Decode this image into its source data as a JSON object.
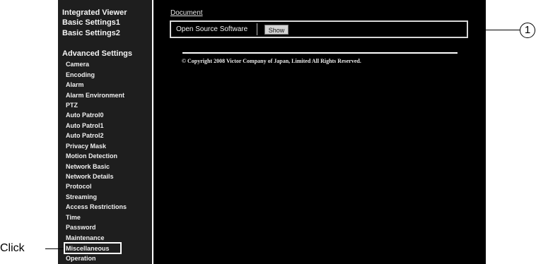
{
  "sidebar": {
    "top_links": [
      "Integrated Viewer",
      "Basic Settings1",
      "Basic Settings2"
    ],
    "section_heading": "Advanced Settings",
    "items": [
      "Camera",
      "Encoding",
      "Alarm",
      "Alarm Environment",
      "PTZ",
      "Auto Patrol0",
      "Auto Patrol1",
      "Auto Patrol2",
      "Privacy Mask",
      "Motion Detection",
      "Network Basic",
      "Network Details",
      "Protocol",
      "Streaming",
      "Access Restrictions",
      "Time",
      "Password",
      "Maintenance",
      "Miscellaneous",
      "Operation"
    ],
    "selected_item": "Miscellaneous"
  },
  "main": {
    "section_title": "Document",
    "row_label": "Open Source Software",
    "show_button": "Show",
    "copyright": "© Copyright 2008 Victor Company of Japan, Limited All Rights Reserved."
  },
  "annotations": {
    "click_label": "Click",
    "callout_number": "1"
  }
}
